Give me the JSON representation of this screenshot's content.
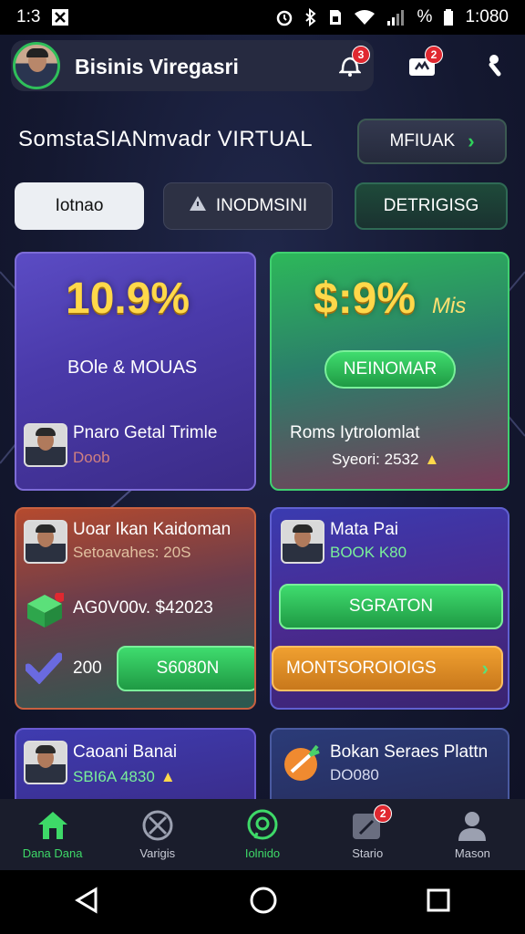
{
  "status_bar": {
    "time_left": "1:3",
    "battery": "%",
    "time": "1:080"
  },
  "header": {
    "title": "Bisinis Viregasri",
    "notif_badge_1": "3",
    "notif_badge_2": "2"
  },
  "subtitle": "SomstaSIANmvadr VIRTUAL",
  "top_button": {
    "label": "MFIUAK"
  },
  "tabs": [
    {
      "label": "Iotnao"
    },
    {
      "label": "INODMSINI"
    },
    {
      "label": "DETRIGISG"
    }
  ],
  "cards": {
    "card1": {
      "value": "10.9%",
      "caption": "BOle & MOUAS",
      "name": "Pnaro Getal Trimle",
      "sub": "Doob"
    },
    "card2": {
      "value": "$:9%",
      "value_suffix": "Mis",
      "button": "NEINOMAR",
      "name": "Roms Iytrolomlat",
      "sub": "Syeori: 2532"
    },
    "card3": {
      "name": "Uoar Ikan Kaidoman",
      "sub": "Setoavahes: 20S",
      "row1": "AG0V00v. $42023",
      "row2_value": "200",
      "button": "S6080N"
    },
    "card4": {
      "name": "Mata Pai",
      "sub": "BOOK K80",
      "button": "SGRATON",
      "button2": "MONTSOROIOIGS"
    },
    "card5": {
      "name": "Caoani Banai",
      "sub": "SBI6A 4830"
    },
    "card6": {
      "name": "Bokan Seraes Plattn",
      "sub": "DO080"
    }
  },
  "bottom_nav": [
    {
      "label": "Dana Dana"
    },
    {
      "label": "Varigis"
    },
    {
      "label": "Iolnido"
    },
    {
      "label": "Stario",
      "badge": "2"
    },
    {
      "label": "Mason"
    }
  ],
  "colors": {
    "accent_green": "#3ed968",
    "gold": "#ffd84a",
    "badge_red": "#e02830"
  }
}
